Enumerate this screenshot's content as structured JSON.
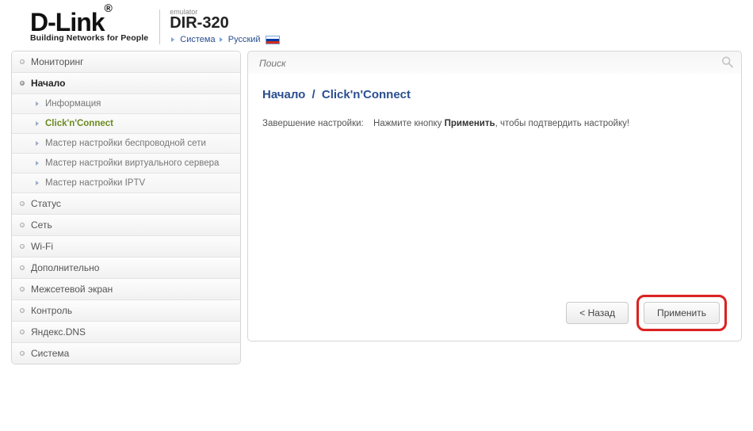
{
  "header": {
    "logo_text": "D-Link",
    "logo_registered": "®",
    "tagline": "Building Networks for People",
    "emulator_label": "emulator",
    "model": "DIR-320",
    "crumb_system": "Система",
    "crumb_lang": "Русский"
  },
  "sidebar": {
    "items": [
      {
        "label": "Мониторинг",
        "expanded": false
      },
      {
        "label": "Начало",
        "expanded": true,
        "children": [
          {
            "label": "Информация",
            "active": false
          },
          {
            "label": "Click'n'Connect",
            "active": true
          },
          {
            "label": "Мастер настройки беспроводной сети",
            "active": false
          },
          {
            "label": "Мастер настройки виртуального сервера",
            "active": false
          },
          {
            "label": "Мастер настройки IPTV",
            "active": false
          }
        ]
      },
      {
        "label": "Статус",
        "expanded": false
      },
      {
        "label": "Сеть",
        "expanded": false
      },
      {
        "label": "Wi-Fi",
        "expanded": false
      },
      {
        "label": "Дополнительно",
        "expanded": false
      },
      {
        "label": "Межсетевой экран",
        "expanded": false
      },
      {
        "label": "Контроль",
        "expanded": false
      },
      {
        "label": "Яндекс.DNS",
        "expanded": false
      },
      {
        "label": "Система",
        "expanded": false
      }
    ]
  },
  "search": {
    "placeholder": "Поиск"
  },
  "main": {
    "breadcrumb_root": "Начало",
    "breadcrumb_sep": "/",
    "breadcrumb_page": "Click'n'Connect",
    "row_label": "Завершение настройки:",
    "row_value_prefix": "Нажмите кнопку ",
    "row_value_bold": "Применить",
    "row_value_suffix": ", чтобы подтвердить настройку!"
  },
  "buttons": {
    "back": "< Назад",
    "apply": "Применить"
  }
}
